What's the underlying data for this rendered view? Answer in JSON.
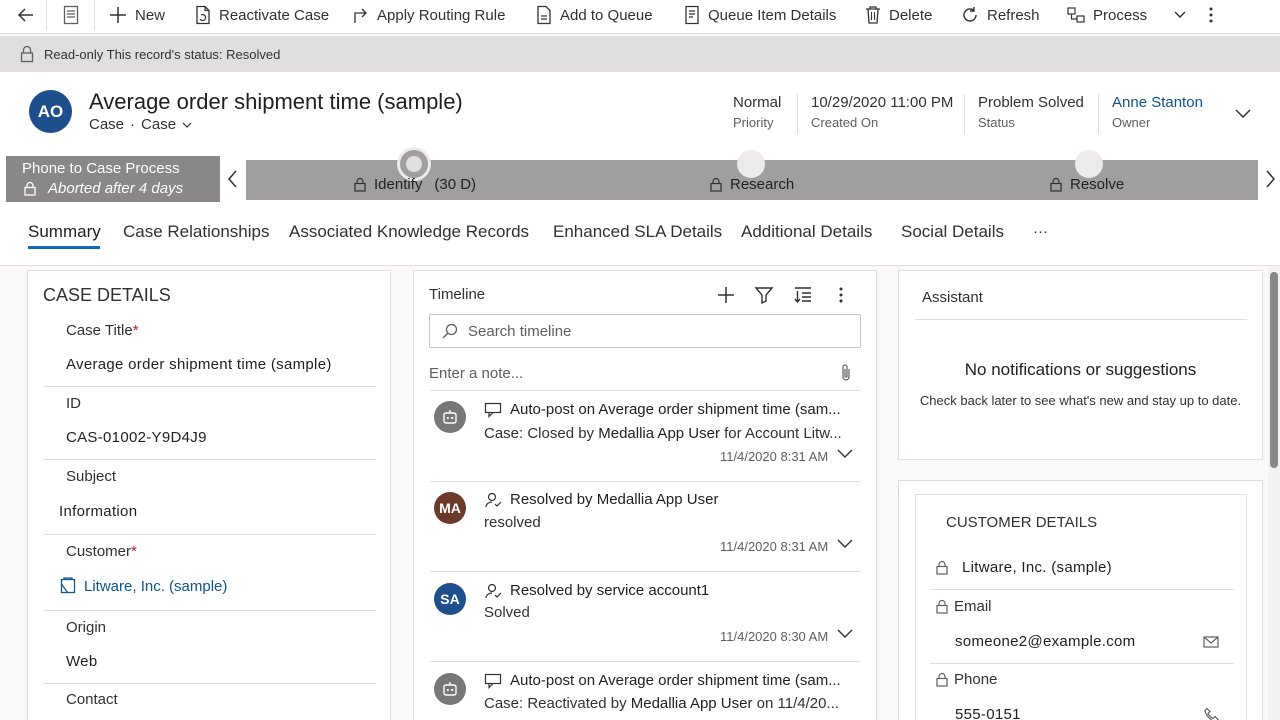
{
  "command_bar": {
    "new": "New",
    "reactivate_case": "Reactivate Case",
    "apply_routing_rule": "Apply Routing Rule",
    "add_to_queue": "Add to Queue",
    "queue_item_details": "Queue Item Details",
    "delete": "Delete",
    "refresh": "Refresh",
    "process": "Process"
  },
  "notice": {
    "text": "Read-only This record's status: Resolved"
  },
  "record": {
    "avatar_initials": "AO",
    "title": "Average order shipment time (sample)",
    "entity": "Case",
    "form": "Case",
    "priority_value": "Normal",
    "priority_label": "Priority",
    "created_on_value": "10/29/2020 11:00 PM",
    "created_on_label": "Created On",
    "status_value": "Problem Solved",
    "status_label": "Status",
    "owner_value": "Anne Stanton",
    "owner_label": "Owner"
  },
  "process": {
    "name": "Phone to Case Process",
    "status": "Aborted after 4 days",
    "stages": [
      {
        "label": "Identify",
        "duration": "(30 D)"
      },
      {
        "label": "Research"
      },
      {
        "label": "Resolve"
      }
    ]
  },
  "tabs": [
    "Summary",
    "Case Relationships",
    "Associated Knowledge Records",
    "Enhanced SLA Details",
    "Additional Details",
    "Social Details",
    "···"
  ],
  "case_details": {
    "heading": "CASE DETAILS",
    "case_title_label": "Case Title",
    "case_title_value": "Average order shipment time (sample)",
    "id_label": "ID",
    "id_value": "CAS-01002-Y9D4J9",
    "subject_label": "Subject",
    "subject_value": "Information",
    "customer_label": "Customer",
    "customer_value": "Litware, Inc. (sample)",
    "origin_label": "Origin",
    "origin_value": "Web",
    "contact_label": "Contact",
    "required_mark": "*"
  },
  "timeline": {
    "title": "Timeline",
    "search_placeholder": "Search timeline",
    "note_placeholder": "Enter a note...",
    "items": [
      {
        "avatar": "",
        "title": "Auto-post on Average order shipment time (sam...",
        "sub_prefix": "Case: Closed by ",
        "sub_bold": "Medallia App User",
        "sub_mid": " for Account ",
        "sub_bold2": "Litw...",
        "date": "11/4/2020 8:31 AM"
      },
      {
        "avatar": "MA",
        "title": "Resolved by Medallia App User",
        "sub_prefix": "resolved",
        "date": "11/4/2020 8:31 AM"
      },
      {
        "avatar": "SA",
        "title": "Resolved by service account1",
        "sub_prefix": "Solved",
        "date": "11/4/2020 8:30 AM"
      },
      {
        "avatar": "",
        "title": "Auto-post on Average order shipment time (sam...",
        "sub_prefix": "Case: Reactivated by ",
        "sub_bold": "Medallia App User",
        "sub_mid": " on 11/4/20...",
        "date": ""
      }
    ]
  },
  "assistant": {
    "title": "Assistant",
    "empty_title": "No notifications or suggestions",
    "empty_sub": "Check back later to see what's new and stay up to date."
  },
  "customer_details": {
    "heading": "CUSTOMER DETAILS",
    "account": "Litware, Inc. (sample)",
    "email_label": "Email",
    "email_value": "someone2@example.com",
    "phone_label": "Phone",
    "phone_value": "555-0151"
  },
  "colors": {
    "accent": "#0f6cbd",
    "link": "#0f548c",
    "avatar_ao": "#1f4e8c",
    "avatar_ma": "#6b3a2a",
    "avatar_sa": "#1f4e8c",
    "bot": "#797775"
  }
}
